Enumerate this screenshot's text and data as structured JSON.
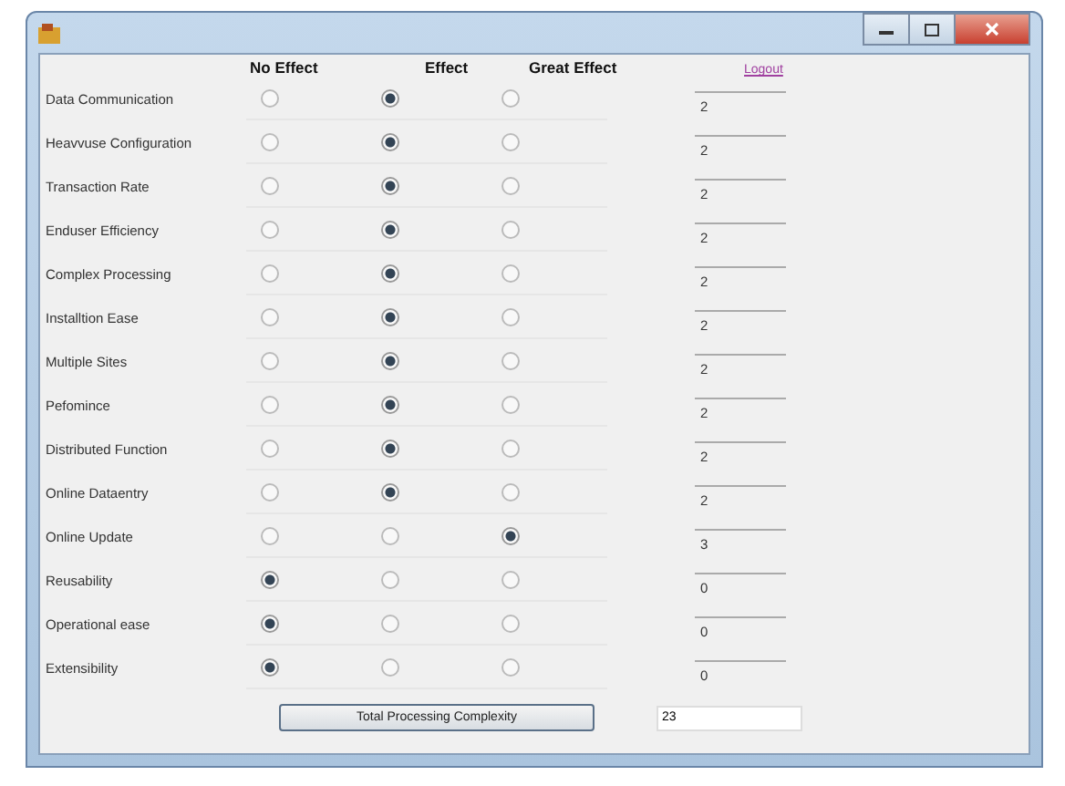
{
  "headers": {
    "column_1": "No Effect",
    "column_2": "Effect",
    "column_3": "Great Effect"
  },
  "logout": "Logout",
  "rows": [
    {
      "label": "Data Communication",
      "options": [
        {
          "selected": false
        },
        {
          "selected": true
        },
        {
          "selected": false
        }
      ],
      "value": "2"
    },
    {
      "label": "Heavvuse Configuration",
      "options": [
        {
          "selected": false
        },
        {
          "selected": true
        },
        {
          "selected": false
        }
      ],
      "value": "2"
    },
    {
      "label": "Transaction Rate",
      "options": [
        {
          "selected": false
        },
        {
          "selected": true
        },
        {
          "selected": false
        }
      ],
      "value": "2"
    },
    {
      "label": "Enduser Efficiency",
      "options": [
        {
          "selected": false
        },
        {
          "selected": true
        },
        {
          "selected": false
        }
      ],
      "value": "2"
    },
    {
      "label": "Complex Processing",
      "options": [
        {
          "selected": false
        },
        {
          "selected": true
        },
        {
          "selected": false
        }
      ],
      "value": "2"
    },
    {
      "label": "Installtion Ease",
      "options": [
        {
          "selected": false
        },
        {
          "selected": true
        },
        {
          "selected": false
        }
      ],
      "value": "2"
    },
    {
      "label": "Multiple Sites",
      "options": [
        {
          "selected": false
        },
        {
          "selected": true
        },
        {
          "selected": false
        }
      ],
      "value": "2"
    },
    {
      "label": "Pefomince",
      "options": [
        {
          "selected": false
        },
        {
          "selected": true
        },
        {
          "selected": false
        }
      ],
      "value": "2"
    },
    {
      "label": "Distributed Function",
      "options": [
        {
          "selected": false
        },
        {
          "selected": true
        },
        {
          "selected": false
        }
      ],
      "value": "2"
    },
    {
      "label": "Online Dataentry",
      "options": [
        {
          "selected": false
        },
        {
          "selected": true
        },
        {
          "selected": false
        }
      ],
      "value": "2"
    },
    {
      "label": "Online Update",
      "options": [
        {
          "selected": false
        },
        {
          "selected": false
        },
        {
          "selected": true
        }
      ],
      "value": "3"
    },
    {
      "label": "Reusability",
      "options": [
        {
          "selected": true
        },
        {
          "selected": false
        },
        {
          "selected": false
        }
      ],
      "value": "0"
    },
    {
      "label": "Operational ease",
      "options": [
        {
          "selected": true
        },
        {
          "selected": false
        },
        {
          "selected": false
        }
      ],
      "value": "0"
    },
    {
      "label": "Extensibility",
      "options": [
        {
          "selected": true
        },
        {
          "selected": false
        },
        {
          "selected": false
        }
      ],
      "value": "0"
    }
  ],
  "total_button": "Total Processing Complexity",
  "total_value": "23"
}
